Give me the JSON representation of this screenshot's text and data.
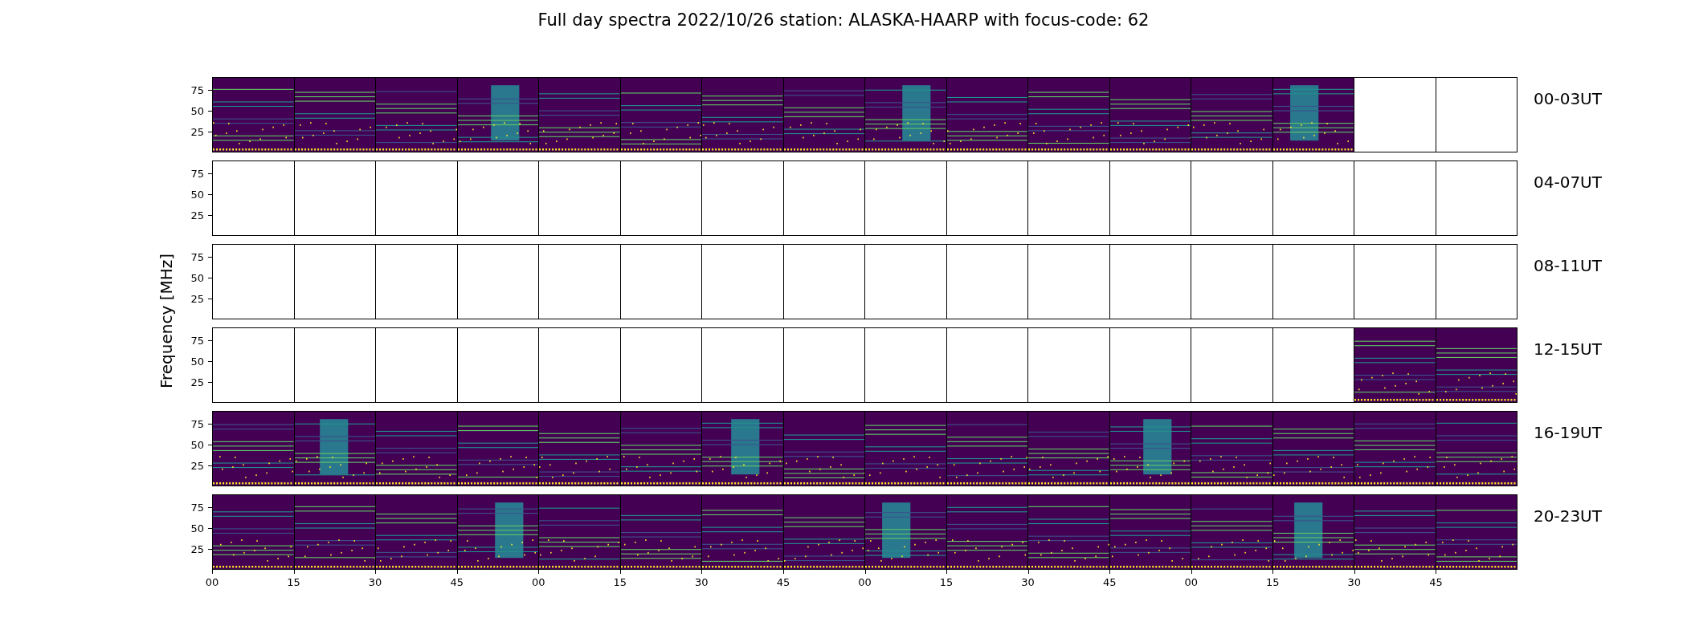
{
  "title": "Full day spectra 2022/10/26 station: ALASKA-HAARP with focus-code: 62",
  "ylabel": "Frequency [MHz]",
  "rows": [
    {
      "label": "00-03UT",
      "y_ticks": [
        "75",
        "50",
        "25"
      ],
      "panels": [
        {
          "has_data": true
        },
        {
          "has_data": true
        },
        {
          "has_data": true
        },
        {
          "has_data": true
        },
        {
          "has_data": true
        },
        {
          "has_data": true
        },
        {
          "has_data": true
        },
        {
          "has_data": true
        },
        {
          "has_data": true
        },
        {
          "has_data": true
        },
        {
          "has_data": true
        },
        {
          "has_data": true
        },
        {
          "has_data": true
        },
        {
          "has_data": true
        },
        {
          "has_data": false
        },
        {
          "has_data": false
        }
      ]
    },
    {
      "label": "04-07UT",
      "y_ticks": [
        "75",
        "50",
        "25"
      ],
      "panels": [
        {
          "has_data": false
        },
        {
          "has_data": false
        },
        {
          "has_data": false
        },
        {
          "has_data": false
        },
        {
          "has_data": false
        },
        {
          "has_data": false
        },
        {
          "has_data": false
        },
        {
          "has_data": false
        },
        {
          "has_data": false
        },
        {
          "has_data": false
        },
        {
          "has_data": false
        },
        {
          "has_data": false
        },
        {
          "has_data": false
        },
        {
          "has_data": false
        },
        {
          "has_data": false
        },
        {
          "has_data": false
        }
      ]
    },
    {
      "label": "08-11UT",
      "y_ticks": [
        "75",
        "50",
        "25"
      ],
      "panels": [
        {
          "has_data": false
        },
        {
          "has_data": false
        },
        {
          "has_data": false
        },
        {
          "has_data": false
        },
        {
          "has_data": false
        },
        {
          "has_data": false
        },
        {
          "has_data": false
        },
        {
          "has_data": false
        },
        {
          "has_data": false
        },
        {
          "has_data": false
        },
        {
          "has_data": false
        },
        {
          "has_data": false
        },
        {
          "has_data": false
        },
        {
          "has_data": false
        },
        {
          "has_data": false
        },
        {
          "has_data": false
        }
      ]
    },
    {
      "label": "12-15UT",
      "y_ticks": [
        "75",
        "50",
        "25"
      ],
      "panels": [
        {
          "has_data": false
        },
        {
          "has_data": false
        },
        {
          "has_data": false
        },
        {
          "has_data": false
        },
        {
          "has_data": false
        },
        {
          "has_data": false
        },
        {
          "has_data": false
        },
        {
          "has_data": false
        },
        {
          "has_data": false
        },
        {
          "has_data": false
        },
        {
          "has_data": false
        },
        {
          "has_data": false
        },
        {
          "has_data": false
        },
        {
          "has_data": false
        },
        {
          "has_data": true
        },
        {
          "has_data": true
        }
      ]
    },
    {
      "label": "16-19UT",
      "y_ticks": [
        "75",
        "50",
        "25"
      ],
      "panels": [
        {
          "has_data": true
        },
        {
          "has_data": true
        },
        {
          "has_data": true
        },
        {
          "has_data": true
        },
        {
          "has_data": true
        },
        {
          "has_data": true
        },
        {
          "has_data": true
        },
        {
          "has_data": true
        },
        {
          "has_data": true
        },
        {
          "has_data": true
        },
        {
          "has_data": true
        },
        {
          "has_data": true
        },
        {
          "has_data": true
        },
        {
          "has_data": true
        },
        {
          "has_data": true
        },
        {
          "has_data": true
        }
      ]
    },
    {
      "label": "20-23UT",
      "y_ticks": [
        "75",
        "50",
        "25"
      ],
      "panels": [
        {
          "has_data": true
        },
        {
          "has_data": true
        },
        {
          "has_data": true
        },
        {
          "has_data": true
        },
        {
          "has_data": true
        },
        {
          "has_data": true
        },
        {
          "has_data": true
        },
        {
          "has_data": true
        },
        {
          "has_data": true
        },
        {
          "has_data": true
        },
        {
          "has_data": true
        },
        {
          "has_data": true
        },
        {
          "has_data": true
        },
        {
          "has_data": true
        },
        {
          "has_data": true
        },
        {
          "has_data": true
        }
      ]
    }
  ],
  "x_ticks": [
    "00",
    "15",
    "30",
    "45",
    "00",
    "15",
    "30",
    "45",
    "00",
    "15",
    "30",
    "45",
    "00",
    "15",
    "30",
    "45"
  ]
}
